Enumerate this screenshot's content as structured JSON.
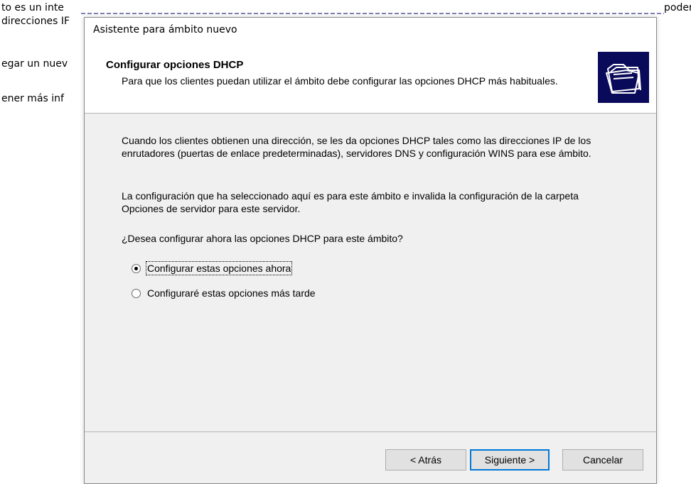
{
  "background_window": {
    "line1_left": "to es un inte",
    "line1_right": "poder",
    "line2": "direcciones IF",
    "line3": "egar un nuev",
    "line4": "ener más inf"
  },
  "dialog": {
    "title": "Asistente para ámbito nuevo",
    "header": {
      "title": "Configurar opciones DHCP",
      "subtitle": "Para que los clientes puedan utilizar el ámbito debe configurar las opciones DHCP más habituales.",
      "icon": "folders-icon"
    },
    "body": {
      "paragraph1": "Cuando los clientes obtienen una dirección, se les da opciones DHCP tales como las direcciones IP de los enrutadores (puertas de enlace predeterminadas), servidores DNS y configuración WINS para ese ámbito.",
      "paragraph2": "La configuración que ha seleccionado aquí es para este ámbito e invalida la configuración de la carpeta Opciones de servidor para este servidor.",
      "question": "¿Desea configurar ahora las opciones DHCP para este ámbito?",
      "options": [
        {
          "label": "Configurar estas opciones ahora",
          "selected": true
        },
        {
          "label": "Configuraré estas opciones más tarde",
          "selected": false
        }
      ]
    },
    "buttons": {
      "back": "< Atrás",
      "next": "Siguiente >",
      "cancel": "Cancelar"
    }
  },
  "colors": {
    "content_bg": "#f0f0f0",
    "icon_bg": "#0a0a5a",
    "default_button_border": "#0078d7"
  }
}
